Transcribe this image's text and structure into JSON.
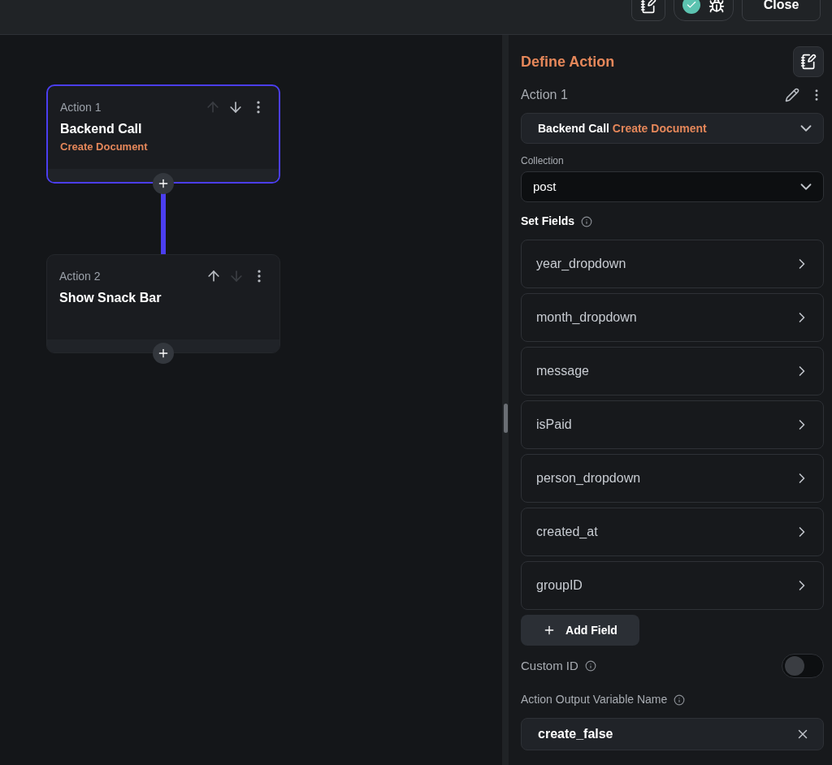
{
  "toolbar": {
    "close_label": "Close",
    "status_ok": true
  },
  "actions": [
    {
      "label": "Action 1",
      "title": "Backend Call",
      "subtitle": "Create Document",
      "selected": true,
      "up_disabled": true,
      "down_disabled": false
    },
    {
      "label": "Action 2",
      "title": "Show Snack Bar",
      "selected": false,
      "up_disabled": false,
      "down_disabled": true
    }
  ],
  "panel": {
    "title": "Define Action",
    "action_label": "Action 1",
    "action_type": "Backend Call",
    "action_subtype": "Create Document",
    "collection_label": "Collection",
    "collection_value": "post",
    "set_fields_label": "Set Fields",
    "fields": [
      "year_dropdown",
      "month_dropdown",
      "message",
      "isPaid",
      "person_dropdown",
      "created_at",
      "groupID"
    ],
    "add_field_label": "Add Field",
    "custom_id": {
      "label": "Custom ID",
      "on": false
    },
    "output_label": "Action Output Variable Name",
    "output_value": "create_false"
  }
}
